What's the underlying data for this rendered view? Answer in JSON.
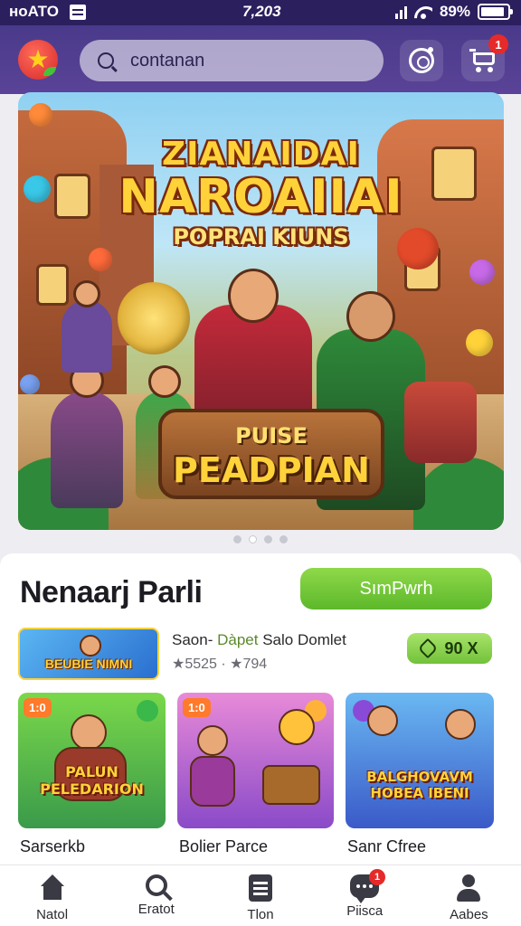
{
  "status_bar": {
    "carrier": "ноATO",
    "time": "7,203",
    "battery": "89%",
    "battery_level": 0.89
  },
  "header": {
    "search_value": "contanan",
    "cart_badge": "1",
    "icons": [
      "app-logo-icon",
      "search-icon",
      "camera-icon",
      "cart-icon"
    ]
  },
  "banner": {
    "title_line1": "ZIANAIDAI",
    "title_line2": "NAROAIIAI",
    "title_line3": "POPRAI KIUNS",
    "plaque_line1": "PUISE",
    "plaque_line2": "PEADPIAN",
    "carousel_pages": 4,
    "active_page": 2
  },
  "section": {
    "title": "Nenaarj Parli",
    "cta_label": "SımPwrh"
  },
  "featured": {
    "thumb_caption": "BEUBIE NIMNI",
    "title_prefix": "Saon-",
    "title_accent": "Dàpet",
    "title_suffix": "Salo Domlet",
    "meta": "★5525 · ★794",
    "price": "90 X"
  },
  "cards": [
    {
      "badge": "1:0",
      "caption": "PALUN PELEDARION",
      "label": "Sarserkb",
      "bg": "#58b86a"
    },
    {
      "badge": "1:0",
      "caption": "",
      "label": "Bolier Parce",
      "bg": "#a05ad2"
    },
    {
      "badge": "",
      "caption": "BALGHOVAVM HOBEA IBENI",
      "label": "Sanr Cfree",
      "bg": "#4a8ad8"
    }
  ],
  "bottom_nav": [
    {
      "label": "Natol",
      "icon": "home-icon"
    },
    {
      "label": "Eratot",
      "icon": "search-icon"
    },
    {
      "label": "Tlon",
      "icon": "list-icon"
    },
    {
      "label": "Piisca",
      "icon": "chat-icon",
      "badge": "1"
    },
    {
      "label": "Aabes",
      "icon": "profile-icon"
    }
  ],
  "colors": {
    "header": "#4a3a8a",
    "accent_green": "#6cc13a",
    "badge_red": "#e52a2a",
    "title_gold": "#ffd23a"
  }
}
